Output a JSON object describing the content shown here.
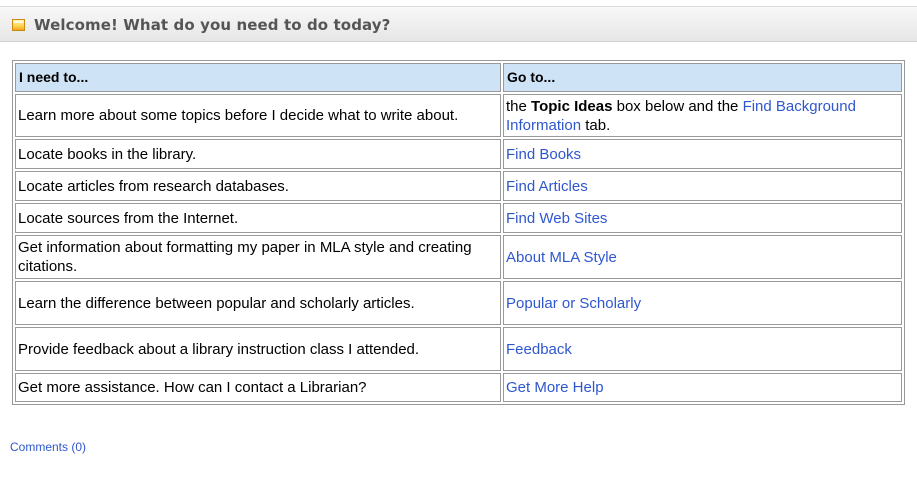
{
  "panel": {
    "title": "Welcome! What do you need to do today?",
    "icon": "note-box-icon"
  },
  "table": {
    "headers": [
      "I need to...",
      "Go to..."
    ],
    "rows": [
      {
        "need": "Learn more about some topics before I decide what to write about.",
        "goto_prefix": "the",
        "goto_bold": "Topic Ideas",
        "goto_middle": "box below and the",
        "goto_link": "Find Background Information",
        "goto_suffix": "tab."
      },
      {
        "need": "Locate books in the library.",
        "link": "Find Books"
      },
      {
        "need": "Locate articles from research databases.",
        "link": "Find Articles"
      },
      {
        "need": "Locate sources from the Internet.",
        "link": "Find Web Sites"
      },
      {
        "need": "Get information about formatting my paper in MLA style and creating citations.",
        "link": "About MLA Style"
      },
      {
        "need": "Learn the difference between popular and scholarly articles.",
        "link": "Popular or Scholarly"
      },
      {
        "need": "Provide feedback about a library instruction class I attended.",
        "link": "Feedback"
      },
      {
        "need": "Get more assistance. How can I contact a Librarian?",
        "link": "Get More Help"
      }
    ]
  },
  "comments": {
    "label": "Comments (0)"
  },
  "colors": {
    "link": "#2f57cf",
    "header_bg": "#cfe3f6",
    "panel_bg": "#eeeeee",
    "title_text": "#555555"
  }
}
